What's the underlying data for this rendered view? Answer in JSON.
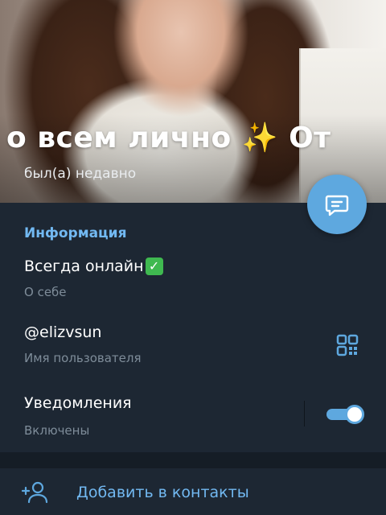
{
  "header": {
    "name": "о всем лично ✨   От",
    "status": "был(а) недавно"
  },
  "info": {
    "section_title": "Информация",
    "bio": {
      "value": "Всегда онлайн",
      "label": "О себе"
    },
    "username": {
      "value": "@elizvsun",
      "label": "Имя пользователя"
    },
    "notifications": {
      "value": "Уведомления",
      "label": "Включены",
      "enabled": true
    }
  },
  "actions": {
    "add_contact": "Добавить в контакты"
  },
  "colors": {
    "background": "#1d2733",
    "accent": "#5ea8df",
    "link": "#72b9f2",
    "secondary_text": "#7e8c99"
  },
  "icons": [
    "message-icon",
    "check-emoji-icon",
    "qr-code-icon",
    "toggle-switch",
    "add-person-icon"
  ]
}
